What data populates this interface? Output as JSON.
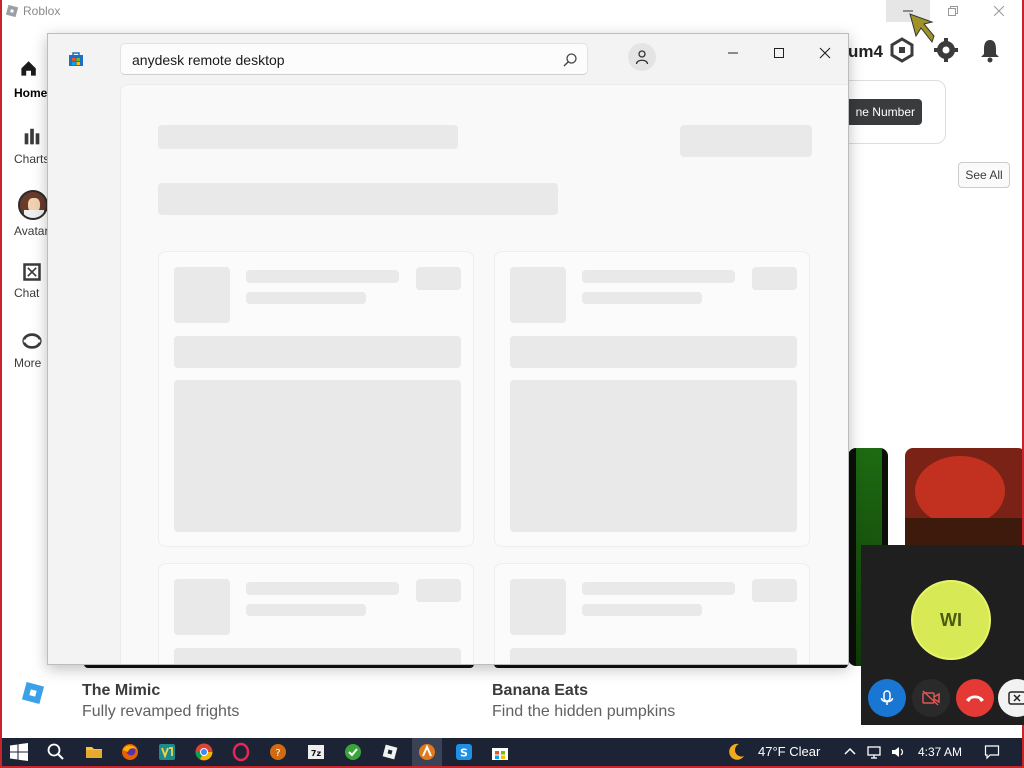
{
  "roblox": {
    "window_title": "Roblox",
    "nav": [
      {
        "label": "Home"
      },
      {
        "label": "Charts"
      },
      {
        "label": "Avatar"
      },
      {
        "label": "Chat"
      },
      {
        "label": "More"
      }
    ],
    "username_partial": "um4",
    "phone_button_label": "ne Number",
    "see_all_label": "See All",
    "games": [
      {
        "title": "The Mimic",
        "subtitle": "Fully revamped frights"
      },
      {
        "title": "Banana Eats",
        "subtitle": "Find the hidden pumpkins"
      }
    ]
  },
  "store": {
    "search_value": "anydesk remote desktop"
  },
  "call": {
    "initials": "WI"
  },
  "taskbar": {
    "weather": "47°F  Clear",
    "time": "4:37 AM"
  },
  "colors": {
    "desktop_border": "#c8242b",
    "taskbar": "#1c2334",
    "call_avatar": "#d7ea55",
    "call_mic": "#1976d2",
    "call_end": "#e53935"
  }
}
